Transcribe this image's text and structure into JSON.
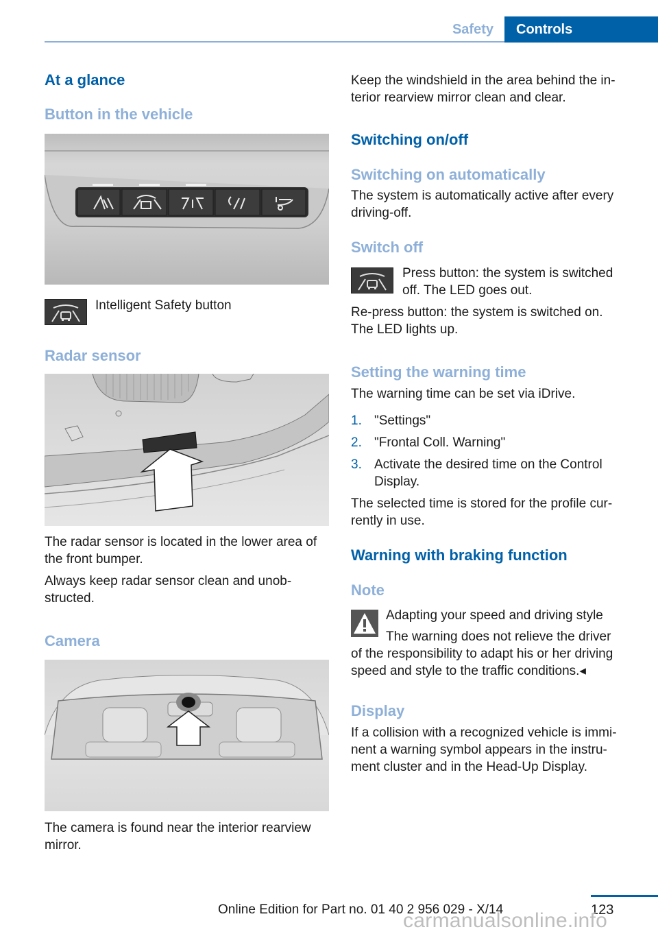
{
  "header": {
    "tabs": [
      {
        "label": "Safety",
        "active": false
      },
      {
        "label": "Controls",
        "active": true
      }
    ],
    "accent_color": "#0060a8",
    "muted_color": "#8eb0d8"
  },
  "left_column": {
    "section_title": "At a glance",
    "button_heading": "Button in the vehicle",
    "button_figure_alt": "Driver assistance button bank in the vehicle (five buttons with LEDs)",
    "button_caption": "Intelligent Safety button",
    "radar_heading": "Radar sensor",
    "radar_figure_alt": "Front bumper with arrow pointing to radar sensor",
    "radar_text_1": "The radar sensor is located in the lower area of the front bumper.",
    "radar_text_1_lines": [
      "The radar sensor is located in the lower area of",
      "the front bumper."
    ],
    "radar_text_2_lines": [
      "Always keep radar sensor clean and unob-",
      "structed."
    ],
    "camera_heading": "Camera",
    "camera_figure_alt": "Windshield with arrow pointing to camera near interior rearview mirror",
    "camera_text_lines": [
      "The camera is found near the interior rearview",
      "mirror."
    ]
  },
  "right_column": {
    "intro_lines": [
      "Keep the windshield in the area behind the in-",
      "terior rearview mirror clean and clear."
    ],
    "switching_heading": "Switching on/off",
    "auto_heading": "Switching on automatically",
    "auto_text_lines": [
      "The system is automatically active after every",
      "driving-off."
    ],
    "switch_off_heading": "Switch off",
    "switch_off_text_lines": [
      "Press button: the system is switched",
      "off. The LED goes out."
    ],
    "repress_text_lines": [
      "Re-press button: the system is switched on.",
      "The LED lights up."
    ],
    "warning_time_heading": "Setting the warning time",
    "warning_time_text": "The warning time can be set via iDrive.",
    "steps": [
      {
        "num": "1.",
        "lines": [
          "\"Settings\""
        ]
      },
      {
        "num": "2.",
        "lines": [
          "\"Frontal Coll. Warning\""
        ]
      },
      {
        "num": "3.",
        "lines": [
          "Activate the desired time on the Control",
          "Display."
        ]
      }
    ],
    "stored_text_lines": [
      "The selected time is stored for the profile cur-",
      "rently in use."
    ],
    "braking_heading": "Warning with braking function",
    "note_heading": "Note",
    "note_title": "Adapting your speed and driving style",
    "note_lines": [
      "The warning does not relieve the driver",
      "of the responsibility to adapt his or her driving",
      "speed and style to the traffic conditions.◂"
    ],
    "display_heading": "Display",
    "display_text_lines": [
      "If a collision with a recognized vehicle is immi-",
      "nent a warning symbol appears in the instru-",
      "ment cluster and in the Head-Up Display."
    ]
  },
  "footer": {
    "edition_text": "Online Edition for Part no. 01 40 2 956 029 - X/14",
    "page_number": "123",
    "watermark": "carmanualsonline.info"
  },
  "icons": {
    "intelligent_safety": "intelligent-safety-icon",
    "warning": "warning-triangle-icon"
  }
}
